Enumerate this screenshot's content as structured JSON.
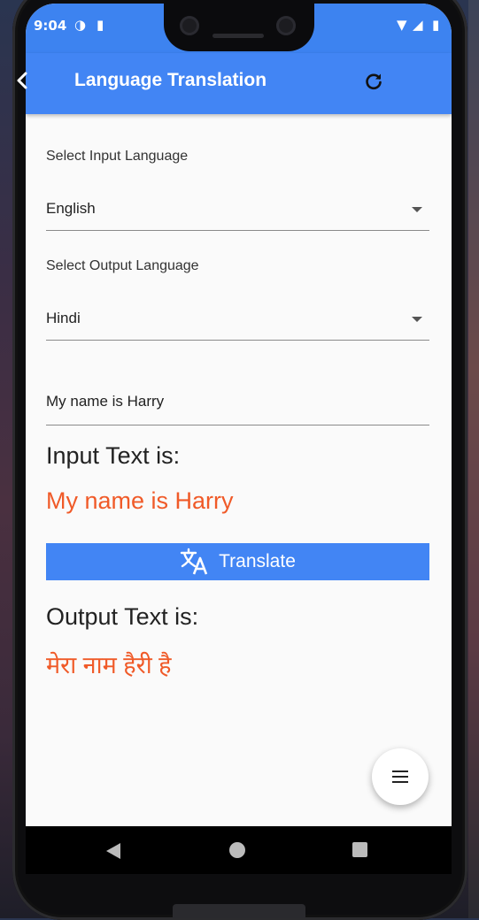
{
  "status": {
    "time": "9:04"
  },
  "appbar": {
    "title": "Language Translation"
  },
  "input_language": {
    "label": "Select Input Language",
    "selected": "English"
  },
  "output_language": {
    "label": "Select Output Language",
    "selected": "Hindi"
  },
  "text_field": {
    "value": "My name is Harry"
  },
  "input_section": {
    "heading": "Input Text is:",
    "text": "My name is Harry"
  },
  "translate_button": {
    "label": "Translate"
  },
  "output_section": {
    "heading": "Output Text is:",
    "text": "मेरा नाम हैरी है"
  },
  "colors": {
    "primary": "#4285f4",
    "accent": "#f05a28"
  }
}
